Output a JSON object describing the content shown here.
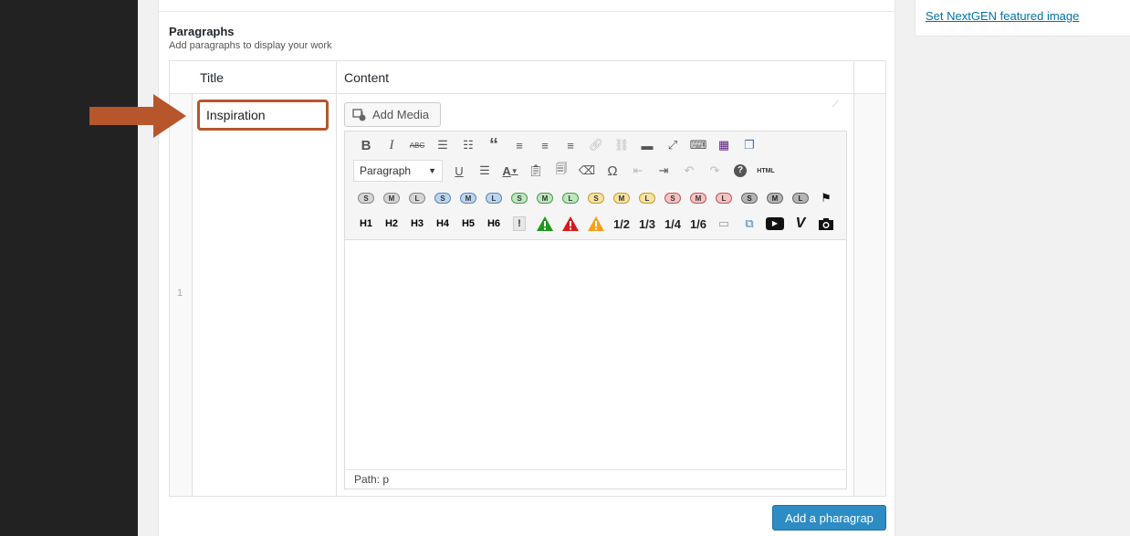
{
  "section": {
    "title": "Paragraphs",
    "description": "Add paragraphs to display your work"
  },
  "table": {
    "col_title": "Title",
    "col_content": "Content",
    "rows": [
      {
        "number": "1",
        "title_value": "Inspiration"
      }
    ]
  },
  "editor": {
    "add_media_label": "Add Media",
    "format_select": "Paragraph",
    "status_path": "Path: p",
    "headings": [
      "H1",
      "H2",
      "H3",
      "H4",
      "H5",
      "H6"
    ],
    "fractions": [
      "1/2",
      "1/3",
      "1/4",
      "1/6"
    ],
    "html_label": "HTML"
  },
  "actions": {
    "add_row_label": "Add a pharagrap"
  },
  "sidebar": {
    "featured_link": "Set NextGEN featured image"
  },
  "colors": {
    "accent": "#b8562b",
    "button_primary": "#2e8cc5",
    "link": "#0073aa"
  }
}
